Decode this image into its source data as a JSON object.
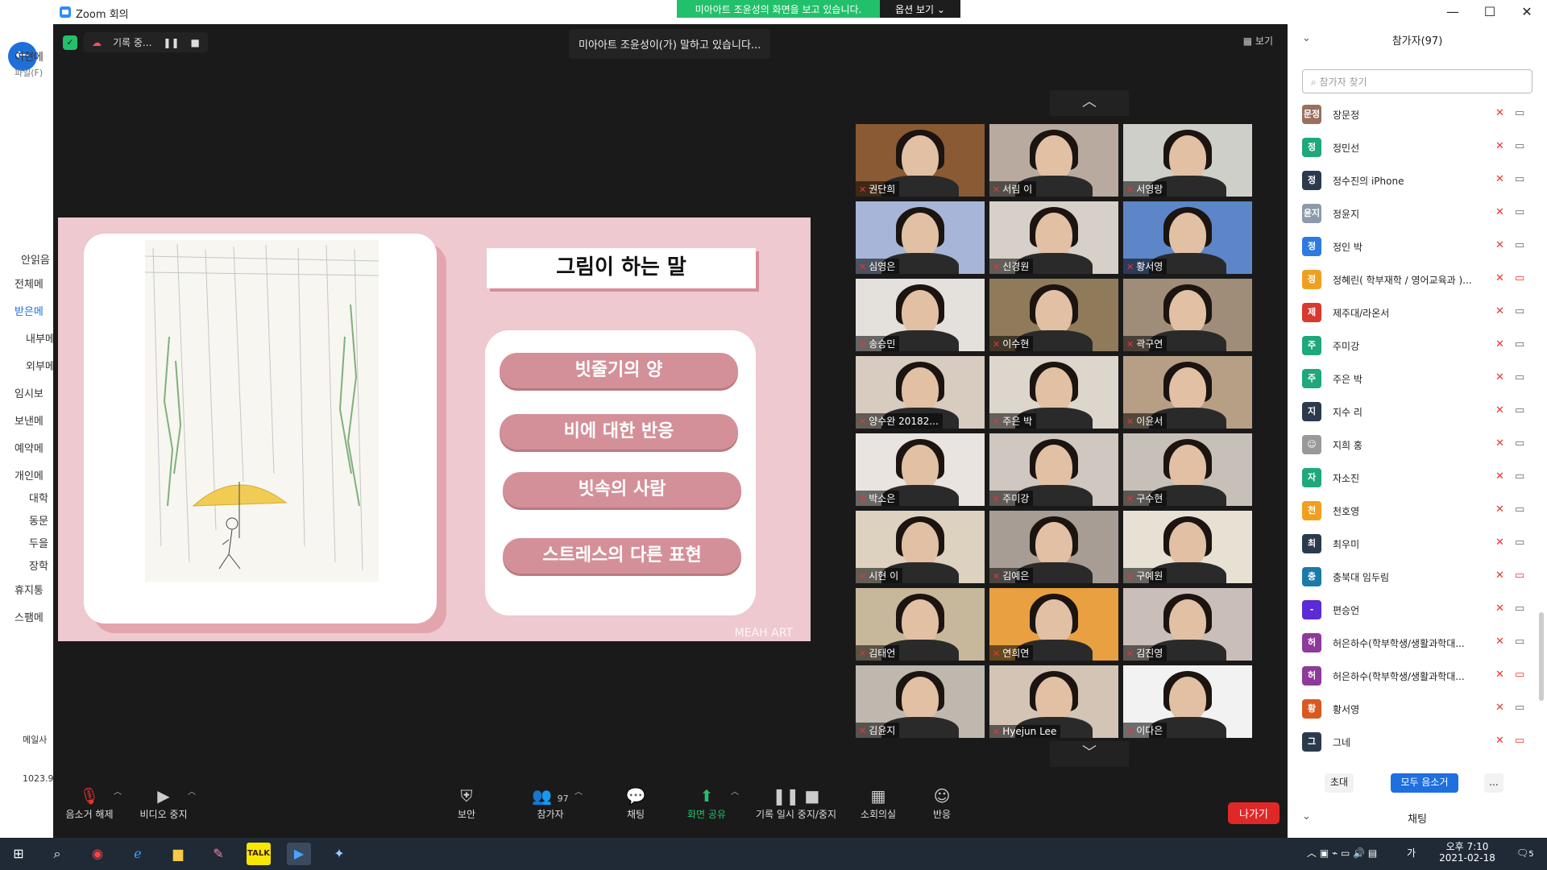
{
  "window": {
    "title": "Zoom 회의",
    "minimize": "—",
    "maximize": "☐",
    "close": "✕"
  },
  "share_bar": {
    "message": "미아아트 조윤성의 화면을 보고 있습니다.",
    "options_label": "옵션 보기 ⌄"
  },
  "left_app": {
    "items": [
      "이현에",
      "파일(F)",
      "안읽음",
      "전체메",
      "받은메",
      "내부메",
      "외부메",
      "임시보",
      "보낸메",
      "예약메",
      "개인메",
      "대학",
      "동문",
      "두을",
      "장학",
      "휴지통",
      "스팸메",
      "메일사",
      "1023.9"
    ]
  },
  "recording": {
    "status": "기록 중...",
    "pause": "❚❚",
    "stop": "■"
  },
  "speaking": "미아아트 조윤성이(가) 말하고 있습니다...",
  "view_label": "▦ 보기",
  "slide": {
    "title": "그림이 하는 말",
    "items": [
      "빗줄기의 양",
      "비에 대한 반응",
      "빗속의 사람",
      "스트레스의 다른 표현"
    ],
    "watermark": "MEAH ART"
  },
  "gallery": {
    "up": "︿",
    "down": "﹀",
    "tiles": [
      {
        "name": "권단희",
        "bg": "#8a5a34"
      },
      {
        "name": "서림 이",
        "bg": "#b9aaa0"
      },
      {
        "name": "서영랑",
        "bg": "#cfcfc9"
      },
      {
        "name": "심영은",
        "bg": "#a7b6d8"
      },
      {
        "name": "신경원",
        "bg": "#d6d0c8"
      },
      {
        "name": "황서영",
        "bg": "#5d86c8"
      },
      {
        "name": "송승민",
        "bg": "#e4e0dc"
      },
      {
        "name": "이수현",
        "bg": "#8f7b5a"
      },
      {
        "name": "곽구연",
        "bg": "#9f8d7a"
      },
      {
        "name": "양수완 20182...",
        "bg": "#d7ccbf"
      },
      {
        "name": "주은 박",
        "bg": "#ddd6cc"
      },
      {
        "name": "이윤서",
        "bg": "#b79f86"
      },
      {
        "name": "박소은",
        "bg": "#e9e4e0"
      },
      {
        "name": "주미강",
        "bg": "#cfc7c0"
      },
      {
        "name": "구수현",
        "bg": "#c7c0b8"
      },
      {
        "name": "시현 이",
        "bg": "#ddd2bf"
      },
      {
        "name": "김예은",
        "bg": "#a89d94"
      },
      {
        "name": "구예원",
        "bg": "#e7e1d3"
      },
      {
        "name": "김태언",
        "bg": "#c8b89b"
      },
      {
        "name": "연희연",
        "bg": "#e9a040"
      },
      {
        "name": "김진영",
        "bg": "#c9bfb8"
      },
      {
        "name": "김윤지",
        "bg": "#bfb8ae"
      },
      {
        "name": "Hyejun Lee",
        "bg": "#d3c4b6"
      },
      {
        "name": "이다은",
        "bg": "#f2f2f2"
      }
    ]
  },
  "toolbar": {
    "unmute": "음소거 해제",
    "stop_video": "비디오 중지",
    "security": "보안",
    "participants": "참가자",
    "participants_count": "97",
    "chat": "채팅",
    "share": "화면 공유",
    "record": "기록 일시 중지/중지",
    "breakout": "소회의실",
    "reactions": "반응",
    "leave": "나가기"
  },
  "panel": {
    "title": "참가자(97)",
    "search_placeholder": "참가자 찾기",
    "participants": [
      {
        "avatar": "문정",
        "name": "장문정",
        "color": "#9a6f5e",
        "video_off": false
      },
      {
        "avatar": "정",
        "name": "정민선",
        "color": "#1fa87a",
        "video_off": false
      },
      {
        "avatar": "정",
        "name": "정수진의 iPhone",
        "color": "#2c3a4d",
        "video_off": false
      },
      {
        "avatar": "윤지",
        "name": "정윤지",
        "color": "#8d9aab",
        "video_off": false
      },
      {
        "avatar": "정",
        "name": "정인 박",
        "color": "#2d7be0",
        "video_off": false
      },
      {
        "avatar": "정",
        "name": "정혜린( 학부재학 / 영어교육과 )...",
        "color": "#f0a020",
        "video_off": true
      },
      {
        "avatar": "제",
        "name": "제주대/라온서",
        "color": "#d83a2e",
        "video_off": false
      },
      {
        "avatar": "주",
        "name": "주미강",
        "color": "#1fa87a",
        "video_off": false
      },
      {
        "avatar": "주",
        "name": "주은 박",
        "color": "#1fa87a",
        "video_off": false
      },
      {
        "avatar": "지",
        "name": "지수 리",
        "color": "#2c3a4d",
        "video_off": false
      },
      {
        "avatar": "☺",
        "name": "지희 홍",
        "color": "#999999",
        "video_off": false
      },
      {
        "avatar": "자",
        "name": "자소진",
        "color": "#1fa87a",
        "video_off": false
      },
      {
        "avatar": "천",
        "name": "천호영",
        "color": "#f0a020",
        "video_off": false
      },
      {
        "avatar": "최",
        "name": "최우미",
        "color": "#2c3a4d",
        "video_off": false
      },
      {
        "avatar": "충",
        "name": "충북대 임두림",
        "color": "#1c7aa8",
        "video_off": true
      },
      {
        "avatar": "-",
        "name": "편승언",
        "color": "#5b2bd6",
        "video_off": false
      },
      {
        "avatar": "허",
        "name": "허은하수(학부학생/생활과학대...",
        "color": "#8e3a9a",
        "video_off": false
      },
      {
        "avatar": "허",
        "name": "허은하수(학부학생/생활과학대...",
        "color": "#8e3a9a",
        "video_off": true
      },
      {
        "avatar": "황",
        "name": "황서영",
        "color": "#d85a20",
        "video_off": false
      },
      {
        "avatar": "그",
        "name": "그네",
        "color": "#2c3a4d",
        "video_off": true
      }
    ],
    "invite": "초대",
    "mute_all": "모두 음소거",
    "more": "...",
    "chat_title": "채팅"
  },
  "taskbar": {
    "time": "오후 7:10",
    "date": "2021-02-18",
    "lang": "가",
    "notif": "5"
  }
}
